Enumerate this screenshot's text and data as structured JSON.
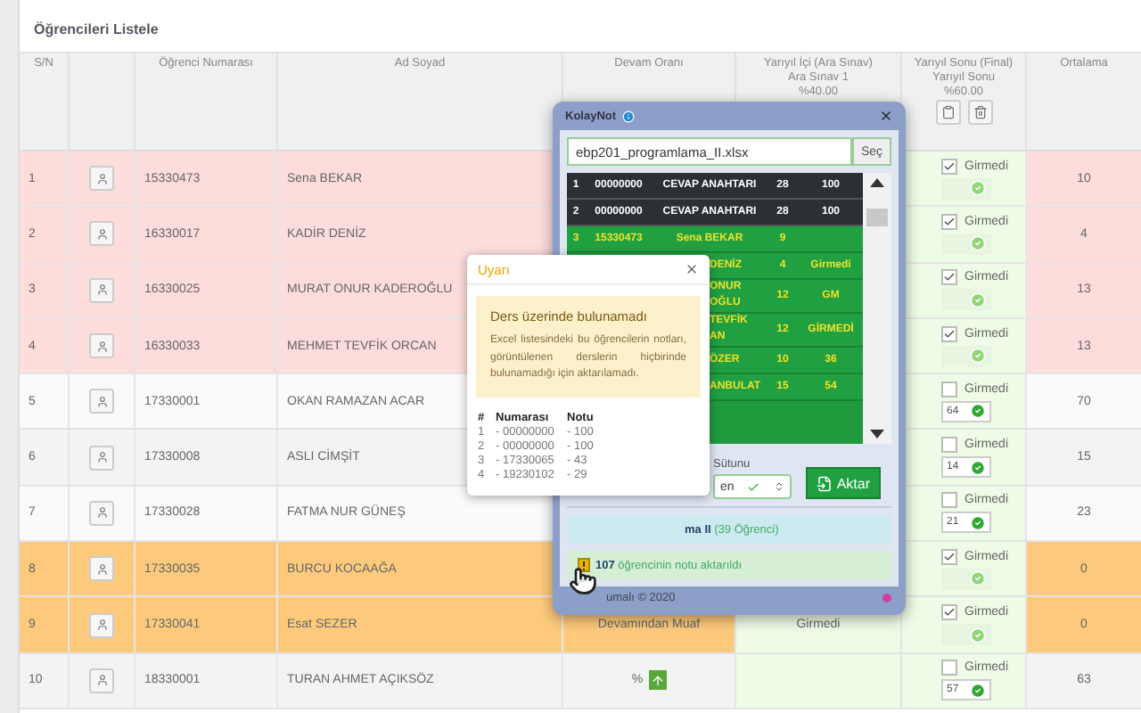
{
  "page_title": "Öğrencileri Listele",
  "columns": {
    "sn": "S/N",
    "number": "Öğrenci Numarası",
    "name": "Ad Soyad",
    "attendance": "Devam Oranı",
    "midterm": {
      "title": "Yarıyıl İçi (Ara Sınav)",
      "exam": "Ara Sınav 1",
      "weight": "%40.00"
    },
    "final": {
      "title": "Yarıyıl Sonu (Final)",
      "exam": "Yarıyıl Sonu",
      "weight": "%60.00"
    },
    "average": "Ortalama"
  },
  "rows": [
    {
      "sn": "1",
      "number": "15330473",
      "name": "Sena BEKAR",
      "kind": "fail",
      "final_label": "Girmedi",
      "final_checked": true,
      "average": "10"
    },
    {
      "sn": "2",
      "number": "16330017",
      "name": "KADİR DENİZ",
      "kind": "fail",
      "final_label": "Girmedi",
      "final_checked": true,
      "average": "4"
    },
    {
      "sn": "3",
      "number": "16330025",
      "name": "MURAT ONUR KADEROĞLU",
      "kind": "fail",
      "final_label": "Girmedi",
      "final_checked": true,
      "average": "13"
    },
    {
      "sn": "4",
      "number": "16330033",
      "name": "MEHMET TEVFİK ORCAN",
      "kind": "fail",
      "final_label": "Girmedi",
      "final_checked": true,
      "average": "13"
    },
    {
      "sn": "5",
      "number": "17330001",
      "name": "OKAN RAMAZAN ACAR",
      "kind": "normal",
      "final_label": "Girmedi",
      "final_checked": false,
      "final_value": "64",
      "average": "70"
    },
    {
      "sn": "6",
      "number": "17330008",
      "name": "ASLI CİMŞİT",
      "kind": "normal",
      "final_label": "Girmedi",
      "final_checked": false,
      "final_value": "14",
      "average": "15"
    },
    {
      "sn": "7",
      "number": "17330028",
      "name": "FATMA NUR GÜNEŞ",
      "kind": "normal",
      "final_label": "Girmedi",
      "final_checked": false,
      "final_value": "21",
      "average": "23"
    },
    {
      "sn": "8",
      "number": "17330035",
      "name": "BURCU KOCAAĞA",
      "kind": "exempt",
      "final_label": "Girmedi",
      "final_checked": true,
      "average": "0"
    },
    {
      "sn": "9",
      "number": "17330041",
      "name": "Esat SEZER",
      "kind": "exempt",
      "attendance": "Devamından Muaf",
      "midterm": "Girmedi",
      "final_label": "Girmedi",
      "final_checked": true,
      "average": "0"
    },
    {
      "sn": "10",
      "number": "18330001",
      "name": "TURAN AHMET AÇIKSÖZ",
      "kind": "normal",
      "attendance": "%",
      "attendance_button": true,
      "final_label": "Girmedi",
      "final_checked": false,
      "final_value": "57",
      "average": "63"
    }
  ],
  "kolaynot": {
    "title": "KolayNot",
    "file": "ebp201_programlama_II.xlsx",
    "choose_button": "Seç",
    "grid": [
      {
        "kind": "key",
        "index": "1",
        "number": "00000000",
        "name": "CEVAP ANAHTARI",
        "score": "28",
        "grade": "100"
      },
      {
        "kind": "key",
        "index": "2",
        "number": "00000000",
        "name": "CEVAP ANAHTARI",
        "score": "28",
        "grade": "100"
      },
      {
        "kind": "match",
        "index": "3",
        "number": "15330473",
        "name": "Sena BEKAR",
        "score": "9"
      },
      {
        "kind": "partial",
        "name": "DENİZ",
        "score": "4",
        "grade": "Girmedi"
      },
      {
        "kind": "partial",
        "name": "ONUR\nOĞLU",
        "score": "12",
        "grade": "GM"
      },
      {
        "kind": "partial",
        "name": "TEVFİK\nAN",
        "score": "12",
        "grade": "GİRMEDİ"
      },
      {
        "kind": "partial",
        "name": "ÖZER",
        "score": "10",
        "grade": "36"
      },
      {
        "kind": "partial",
        "name": "ANBULAT",
        "score": "15",
        "grade": "54"
      }
    ],
    "column_label": "Sütunu",
    "column_select": "en",
    "transfer_button": "Aktar",
    "course_info": "**ma II** (39 Öğrenci)",
    "success": "**107** öğrencinin notu aktarıldı",
    "footer": "umalı © 2020"
  },
  "warning": {
    "title": "Uyarı",
    "heading": "Ders üzerinde bulunamadı",
    "message": "Excel listesindeki bu öğrencilerin notları, görüntülenen derslerin hiçbirinde bulunamadığı için aktarılamadı.",
    "list_headers": [
      "#",
      "Numarası",
      "Notu"
    ],
    "items": [
      {
        "index": "1",
        "number": "- 00000000",
        "grade": "- 100"
      },
      {
        "index": "2",
        "number": "- 00000000",
        "grade": "- 100"
      },
      {
        "index": "3",
        "number": "- 17330065",
        "grade": "- 43"
      },
      {
        "index": "4",
        "number": "- 19230102",
        "grade": "- 29"
      }
    ]
  }
}
